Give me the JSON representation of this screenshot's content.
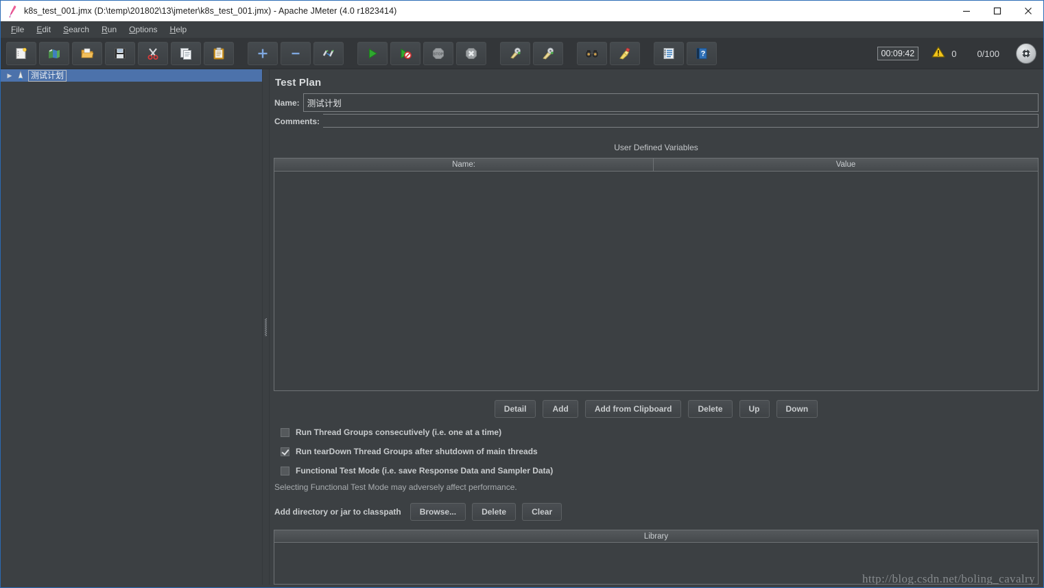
{
  "window": {
    "title": "k8s_test_001.jmx (D:\\temp\\201802\\13\\jmeter\\k8s_test_001.jmx) - Apache JMeter (4.0 r1823414)",
    "app_icon": "jmeter-feather-icon",
    "controls": {
      "minimize": "minimize-icon",
      "maximize": "maximize-icon",
      "close": "close-icon"
    },
    "accent_border": "#2a6bb5"
  },
  "menubar": {
    "items": [
      {
        "mnemonic": "F",
        "rest": "ile"
      },
      {
        "mnemonic": "E",
        "rest": "dit"
      },
      {
        "mnemonic": "S",
        "rest": "earch"
      },
      {
        "mnemonic": "R",
        "rest": "un"
      },
      {
        "mnemonic": "O",
        "rest": "ptions"
      },
      {
        "mnemonic": "H",
        "rest": "elp"
      }
    ]
  },
  "toolbar": {
    "groups": [
      [
        {
          "name": "new-button",
          "glyph": "🗋"
        },
        {
          "name": "templates-button",
          "glyph": "📚"
        },
        {
          "name": "open-button",
          "glyph": "📂"
        },
        {
          "name": "save-button",
          "glyph": "💾"
        },
        {
          "name": "cut-button",
          "glyph": "✂"
        },
        {
          "name": "copy-button",
          "glyph": "❐"
        },
        {
          "name": "paste-button",
          "glyph": "📋"
        }
      ],
      [
        {
          "name": "expand-all-button",
          "glyph": "＋"
        },
        {
          "name": "collapse-all-button",
          "glyph": "−"
        },
        {
          "name": "toggle-button",
          "glyph": "✎"
        }
      ],
      [
        {
          "name": "start-button",
          "glyph": "▶"
        },
        {
          "name": "start-no-pauses-button",
          "glyph": "▷"
        },
        {
          "name": "stop-button",
          "glyph": "⬣"
        },
        {
          "name": "shutdown-button",
          "glyph": "✖"
        }
      ],
      [
        {
          "name": "clear-button",
          "glyph": "🧹"
        },
        {
          "name": "clear-all-button",
          "glyph": "🧹"
        }
      ],
      [
        {
          "name": "search-button",
          "glyph": "🔭"
        },
        {
          "name": "reset-search-button",
          "glyph": "🧹"
        }
      ],
      [
        {
          "name": "function-helper-button",
          "glyph": "🗒"
        },
        {
          "name": "help-button",
          "glyph": "❓"
        }
      ]
    ],
    "status": {
      "timer": "00:09:42",
      "warning_icon": "warning-triangle-icon",
      "warning_count": "0",
      "threads": "0/100",
      "remote_icon": "remote-engines-icon"
    }
  },
  "tree": {
    "root": {
      "arrow": "expand-arrow-icon",
      "icon": "test-plan-icon",
      "label": "测试计划"
    }
  },
  "main": {
    "panel_title": "Test Plan",
    "name_label": "Name:",
    "name_value": "测试计划",
    "comments_label": "Comments:",
    "comments_value": "",
    "udv_title": "User Defined Variables",
    "table": {
      "columns": [
        "Name:",
        "Value"
      ],
      "rows": []
    },
    "table_buttons": [
      {
        "name": "detail-button",
        "label": "Detail"
      },
      {
        "name": "add-button",
        "label": "Add"
      },
      {
        "name": "add-from-clipboard-button",
        "label": "Add from Clipboard"
      },
      {
        "name": "delete-button",
        "label": "Delete"
      },
      {
        "name": "up-button",
        "label": "Up"
      },
      {
        "name": "down-button",
        "label": "Down"
      }
    ],
    "checkboxes": [
      {
        "name": "run-thread-groups-consecutively-checkbox",
        "label": "Run Thread Groups consecutively (i.e. one at a time)",
        "checked": false
      },
      {
        "name": "run-teardown-thread-groups-checkbox",
        "label": "Run tearDown Thread Groups after shutdown of main threads",
        "checked": true
      },
      {
        "name": "functional-test-mode-checkbox",
        "label": "Functional Test Mode (i.e. save Response Data and Sampler Data)",
        "checked": false
      }
    ],
    "hint": "Selecting Functional Test Mode may adversely affect performance.",
    "classpath_label": "Add directory or jar to classpath",
    "classpath_buttons": [
      {
        "name": "browse-button",
        "label": "Browse..."
      },
      {
        "name": "classpath-delete-button",
        "label": "Delete"
      },
      {
        "name": "classpath-clear-button",
        "label": "Clear"
      }
    ],
    "library_header": "Library",
    "library_rows": []
  },
  "watermark": "http://blog.csdn.net/boling_cavalry",
  "colors": {
    "panel_bg": "#3c4043",
    "toolbar_bg": "#333639",
    "selection_blue": "#4c72ab",
    "text": "#c9ccce",
    "border": "#6f7376"
  }
}
